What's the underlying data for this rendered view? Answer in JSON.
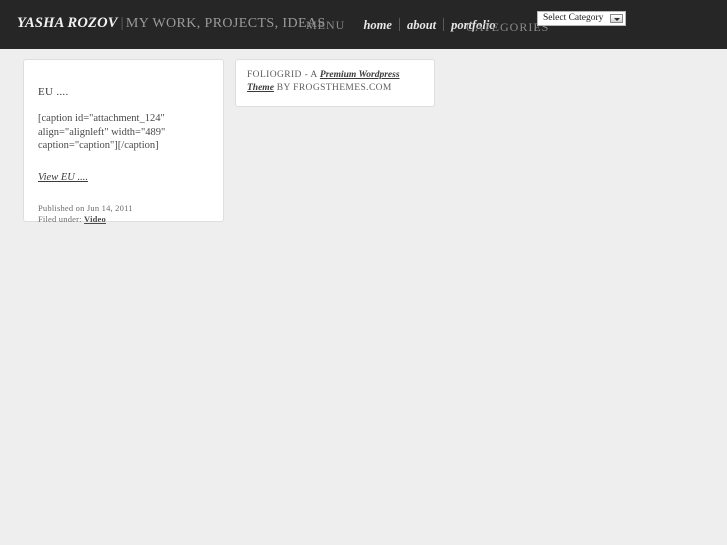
{
  "header": {
    "brand_name": "YASHA ROZOV",
    "brand_separator": "|",
    "brand_tagline": "MY WORK, PROJECTS, IDEAS",
    "menu_label": "MENU",
    "nav": [
      {
        "label": "home"
      },
      {
        "label": "about"
      },
      {
        "label": "portfolio"
      }
    ],
    "categories_label": "CATEGORIES",
    "category_select": {
      "selected": "Select Category",
      "options": [
        "Select Category"
      ]
    }
  },
  "post_card": {
    "title": "EU ....",
    "excerpt": "[caption id=\"attachment_124\" align=\"alignleft\" width=\"489\" caption=\"caption\"][/caption]",
    "more_link": "View EU ....",
    "published_prefix": "Published on",
    "published_date": "Jun 14, 2011",
    "filed_prefix": "Filed under:",
    "filed_category": "Video"
  },
  "promo_card": {
    "lead": "FOLIOGRID - A",
    "link": "Premium Wordpress Theme",
    "mid": "BY",
    "tail": "FROGSTHEMES.COM"
  },
  "colors": {
    "header_bg": "#262626",
    "page_bg": "#efeeee",
    "card_bg": "#ffffff",
    "card_border": "#dedede",
    "brand_name": "#f2f2f2",
    "muted_text": "#8b8b8b"
  }
}
